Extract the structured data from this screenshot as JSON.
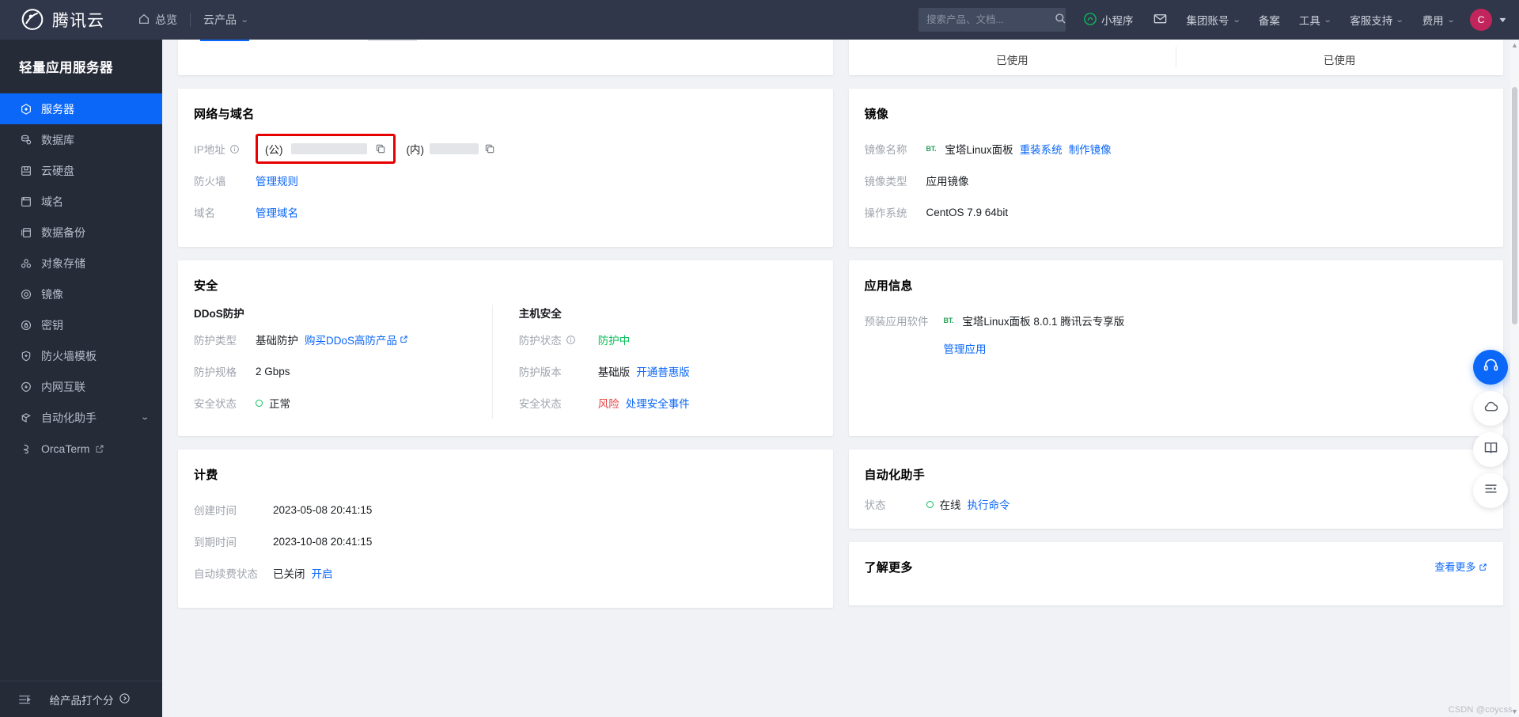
{
  "header": {
    "brand": "腾讯云",
    "nav": [
      {
        "label": "总览",
        "icon": "home-icon",
        "caret": false
      },
      {
        "label": "云产品",
        "icon": "",
        "caret": true
      }
    ],
    "search": {
      "placeholder": "搜索产品、文档...",
      "value": "",
      "icon": "search-icon"
    },
    "right_items": [
      {
        "label": "小程序",
        "icon": "miniprogram-icon",
        "caret": false
      },
      {
        "label": "",
        "icon": "mail-icon",
        "caret": false
      },
      {
        "label": "集团账号",
        "icon": "",
        "caret": true
      },
      {
        "label": "备案",
        "icon": "",
        "caret": false
      },
      {
        "label": "工具",
        "icon": "",
        "caret": true
      },
      {
        "label": "客服支持",
        "icon": "",
        "caret": true
      },
      {
        "label": "费用",
        "icon": "",
        "caret": true
      }
    ],
    "avatar_initial": "C"
  },
  "sidebar": {
    "title": "轻量应用服务器",
    "items": [
      {
        "label": "服务器",
        "icon": "server-icon",
        "active": true,
        "external": false,
        "chevron": false
      },
      {
        "label": "数据库",
        "icon": "database-icon",
        "active": false,
        "external": false,
        "chevron": false
      },
      {
        "label": "云硬盘",
        "icon": "disk-icon",
        "active": false,
        "external": false,
        "chevron": false
      },
      {
        "label": "域名",
        "icon": "domain-icon",
        "active": false,
        "external": false,
        "chevron": false
      },
      {
        "label": "数据备份",
        "icon": "backup-icon",
        "active": false,
        "external": false,
        "chevron": false
      },
      {
        "label": "对象存储",
        "icon": "object-storage-icon",
        "active": false,
        "external": false,
        "chevron": false
      },
      {
        "label": "镜像",
        "icon": "image-icon",
        "active": false,
        "external": false,
        "chevron": false
      },
      {
        "label": "密钥",
        "icon": "key-icon",
        "active": false,
        "external": false,
        "chevron": false
      },
      {
        "label": "防火墙模板",
        "icon": "shield-icon",
        "active": false,
        "external": false,
        "chevron": false
      },
      {
        "label": "内网互联",
        "icon": "network-icon",
        "active": false,
        "external": false,
        "chevron": false
      },
      {
        "label": "自动化助手",
        "icon": "automation-icon",
        "active": false,
        "external": false,
        "chevron": true
      },
      {
        "label": "OrcaTerm",
        "icon": "terminal-icon",
        "active": false,
        "external": true,
        "chevron": false
      }
    ],
    "bottom": {
      "collapse_icon": "collapse-icon",
      "rate_label": "给产品打个分",
      "rate_icon": "arrow-right-circle-icon"
    }
  },
  "top_partial": {
    "used_left": "已使用",
    "used_right": "已使用"
  },
  "cards": {
    "network": {
      "title": "网络与域名",
      "rows": [
        {
          "label": "IP地址",
          "has_info": true,
          "public_prefix": "(公)",
          "private_prefix": "(内)",
          "masked": true
        },
        {
          "label": "防火墙",
          "link": "管理规则"
        },
        {
          "label": "域名",
          "link": "管理域名"
        }
      ]
    },
    "image": {
      "title": "镜像",
      "rows": [
        {
          "label": "镜像名称",
          "badge": "BT.",
          "value": "宝塔Linux面板",
          "links": [
            "重装系统",
            "制作镜像"
          ]
        },
        {
          "label": "镜像类型",
          "value": "应用镜像",
          "links": []
        },
        {
          "label": "操作系统",
          "value": "CentOS 7.9 64bit",
          "links": []
        }
      ]
    },
    "security": {
      "title": "安全",
      "ddos": {
        "sub_title": "DDoS防护",
        "rows": [
          {
            "label": "防护类型",
            "value": "基础防护",
            "link": "购买DDoS高防产品",
            "external": true
          },
          {
            "label": "防护规格",
            "value": "2 Gbps",
            "link": "",
            "external": false
          },
          {
            "label": "安全状态",
            "value": "正常",
            "status": "normal",
            "link": "",
            "external": false
          }
        ]
      },
      "host": {
        "sub_title": "主机安全",
        "rows": [
          {
            "label": "防护状态",
            "has_info": true,
            "value": "防护中",
            "status": "green",
            "link": ""
          },
          {
            "label": "防护版本",
            "has_info": false,
            "value": "基础版",
            "status": "",
            "link": "开通普惠版"
          },
          {
            "label": "安全状态",
            "has_info": false,
            "value": "风险",
            "status": "risk",
            "link": "处理安全事件"
          }
        ]
      }
    },
    "app_info": {
      "title": "应用信息",
      "row_label": "预装应用软件",
      "badge": "BT.",
      "value": "宝塔Linux面板 8.0.1 腾讯云专享版",
      "link": "管理应用"
    },
    "billing": {
      "title": "计费",
      "rows": [
        {
          "label": "创建时间",
          "value": "2023-05-08 20:41:15",
          "link": ""
        },
        {
          "label": "到期时间",
          "value": "2023-10-08 20:41:15",
          "link": ""
        },
        {
          "label": "自动续费状态",
          "value": "已关闭",
          "link": "开启"
        }
      ]
    },
    "automation": {
      "title": "自动化助手",
      "label": "状态",
      "value": "在线",
      "link": "执行命令"
    },
    "learn_more": {
      "title": "了解更多",
      "see_more": "查看更多"
    }
  },
  "fab": [
    {
      "icon": "headset-icon",
      "primary": true
    },
    {
      "icon": "cloud-icon",
      "primary": false
    },
    {
      "icon": "book-icon",
      "primary": false
    },
    {
      "icon": "list-icon",
      "primary": false
    }
  ],
  "watermark": "CSDN @coycss",
  "colors": {
    "accent": "#0b67f7",
    "header_bg": "#30374a",
    "sidebar_bg": "#262b38",
    "page_bg": "#f0f2f5",
    "green": "#0abf5b",
    "red": "#e54545",
    "highlight_border": "#e60000",
    "avatar_bg": "#c2255c"
  }
}
